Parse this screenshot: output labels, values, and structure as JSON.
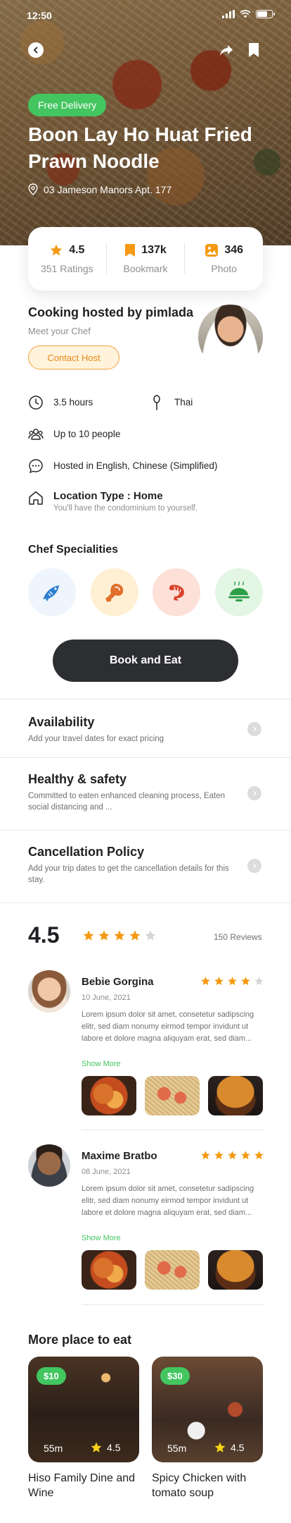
{
  "status": {
    "time": "12:50"
  },
  "hero": {
    "badge": "Free Delivery",
    "title": "Boon Lay Ho Huat Fried Prawn Noodle",
    "address": "03 Jameson Manors Apt. 177"
  },
  "stats": [
    {
      "icon": "star-icon",
      "value": "4.5",
      "label": "351 Ratings"
    },
    {
      "icon": "bookmark-icon",
      "value": "137k",
      "label": "Bookmark"
    },
    {
      "icon": "photo-icon",
      "value": "346",
      "label": "Photo"
    }
  ],
  "host": {
    "title": "Cooking hosted by pimlada",
    "subtitle": "Meet your Chef",
    "contact_label": "Contact Host"
  },
  "details": {
    "duration": "3.5 hours",
    "cuisine": "Thai",
    "guests": "Up to 10 people",
    "languages": "Hosted in English, Chinese (Simplified)",
    "location_title": "Location Type : Home",
    "location_sub": "You'll have the condominium to yourself."
  },
  "specialities": {
    "title": "Chef Specialities",
    "items": [
      {
        "icon": "fish-icon",
        "bg": "#eef5fc",
        "color": "#2f7fd1"
      },
      {
        "icon": "chicken-leg-icon",
        "bg": "#fff0d4",
        "color": "#e0702a"
      },
      {
        "icon": "shrimp-icon",
        "bg": "#fde0d8",
        "color": "#d9432d"
      },
      {
        "icon": "dish-icon",
        "bg": "#e3f6e4",
        "color": "#2e9f48"
      }
    ]
  },
  "book_label": "Book and Eat",
  "info_rows": [
    {
      "title": "Availability",
      "sub": "Add your travel dates for exact pricing"
    },
    {
      "title": "Healthy & safety",
      "sub": "Committed to eaten enhanced cleaning process, Eaten social distancing and ..."
    },
    {
      "title": "Cancellation Policy",
      "sub": "Add your trip dates to get the cancellation details for this stay."
    }
  ],
  "reviews_summary": {
    "rating": "4.5",
    "stars": 4,
    "count": "150 Reviews"
  },
  "reviews": [
    {
      "name": "Bebie Gorgina",
      "date": "10 June, 2021",
      "stars": 4,
      "text": "Lorem ipsum dolor sit amet, consetetur sadipscing elitr, sed diam nonumy eirmod tempor invidunt ut labore et dolore magna aliquyam erat, sed diam...",
      "more": "Show More"
    },
    {
      "name": "Maxime Bratbo",
      "date": "08 June, 2021",
      "stars": 5,
      "text": "Lorem ipsum dolor sit amet, consetetur sadipscing elitr, sed diam nonumy eirmod tempor invidunt ut labore et dolore magna aliquyam erat, sed diam...",
      "more": "Show More"
    }
  ],
  "more_places": {
    "title": "More place to eat",
    "items": [
      {
        "price": "$10",
        "distance": "55m",
        "rating": "4.5",
        "name": "Hiso Family Dine and Wine"
      },
      {
        "price": "$30",
        "distance": "55m",
        "rating": "4.5",
        "name": "Spicy Chicken with tomato soup"
      }
    ]
  },
  "colors": {
    "accent_green": "#43c560",
    "star_orange": "#f59a14",
    "dark_button": "#2c2e31",
    "contact_orange": "#e8871a"
  }
}
